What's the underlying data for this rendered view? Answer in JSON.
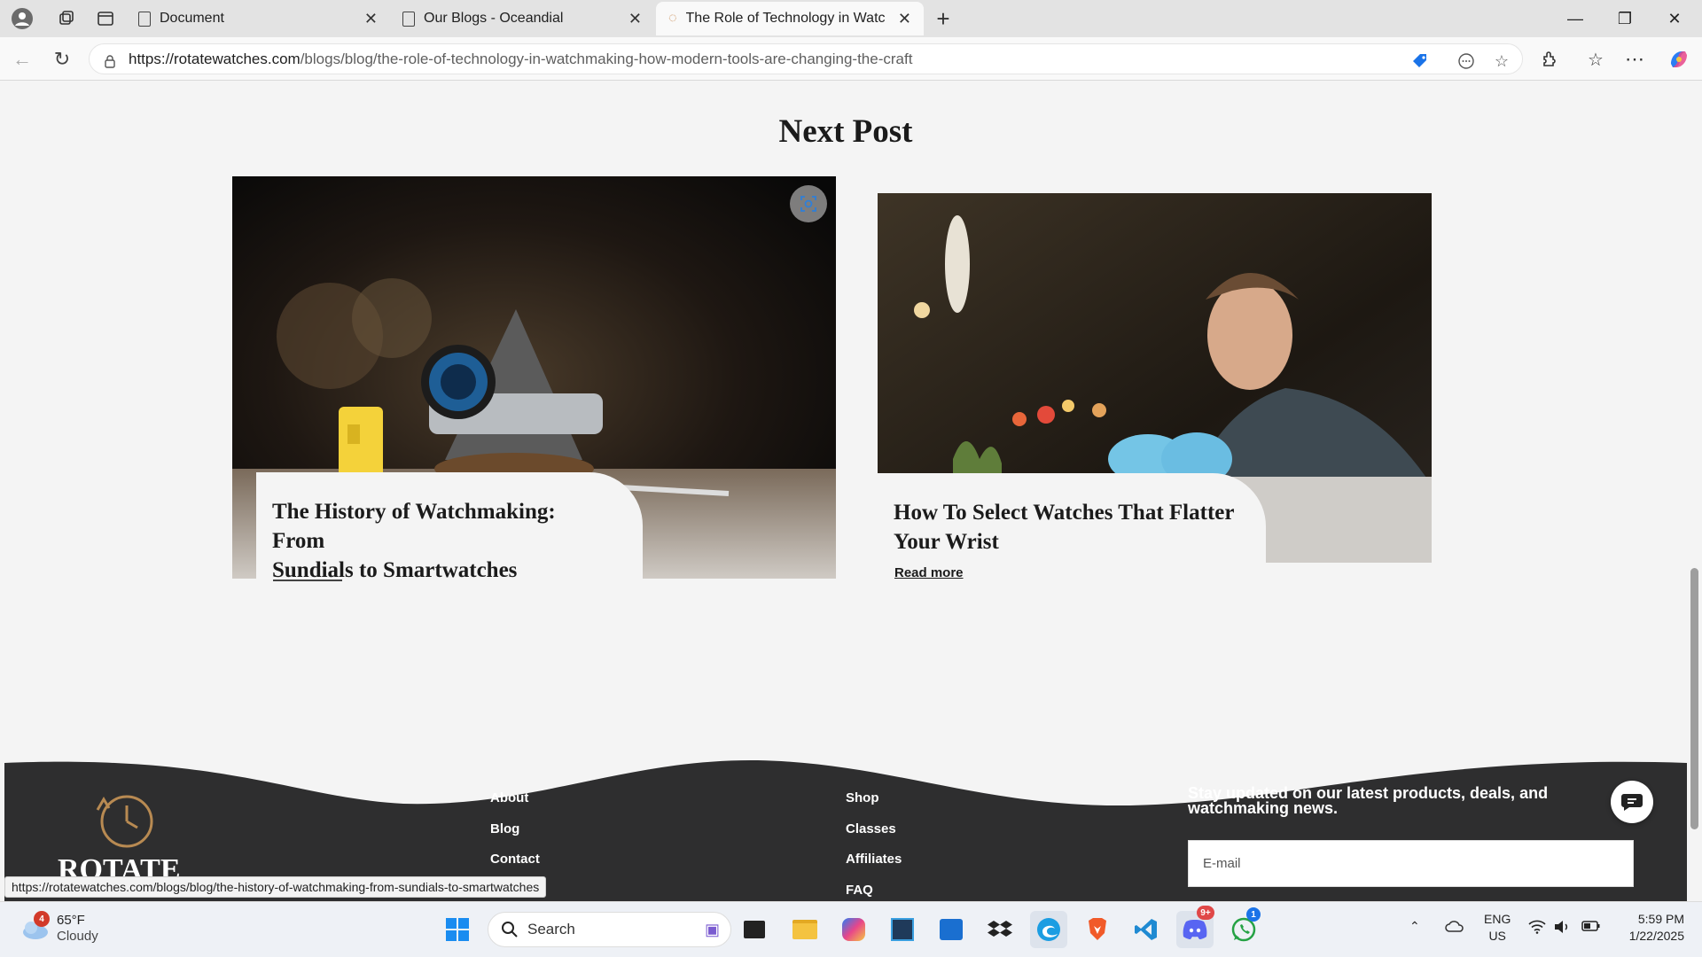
{
  "browser": {
    "tabs": [
      {
        "label": "Document"
      },
      {
        "label": "Our Blogs - Oceandial"
      },
      {
        "label": "The Role of Technology in Watchm"
      }
    ],
    "url_host": "https://rotatewatches.com",
    "url_path": "/blogs/blog/the-role-of-technology-in-watchmaking-how-modern-tools-are-changing-the-craft",
    "status_url": "https://rotatewatches.com/blogs/blog/the-history-of-watchmaking-from-sundials-to-smartwatches"
  },
  "page": {
    "section_title": "Next Post",
    "posts": [
      {
        "title_line1": "The History of Watchmaking: From",
        "title_line2": "Sundials to Smartwatches"
      },
      {
        "title_line1": "How To Select Watches That Flatter",
        "title_line2": "Your Wrist",
        "read_more": "Read more"
      }
    ]
  },
  "footer": {
    "col1": [
      "About",
      "Blog",
      "Contact"
    ],
    "col2": [
      "Shop",
      "Classes",
      "Affiliates",
      "FAQ"
    ],
    "newsletter_line1": "Stay updated on our latest products, deals, and",
    "newsletter_line2": "watchmaking news.",
    "email_placeholder": "E-mail",
    "logo_text": "ROTATE"
  },
  "taskbar": {
    "weather_temp": "65°F",
    "weather_desc": "Cloudy",
    "weather_badge": "4",
    "search_label": "Search",
    "discord_badge": "9+",
    "whatsapp_badge": "1",
    "lang_line1": "ENG",
    "lang_line2": "US",
    "time": "5:59 PM",
    "date": "1/22/2025"
  },
  "colors": {
    "footer_bg": "#2e2e2f",
    "accent_gold": "#b88a52",
    "page_bg": "#f4f4f4"
  }
}
